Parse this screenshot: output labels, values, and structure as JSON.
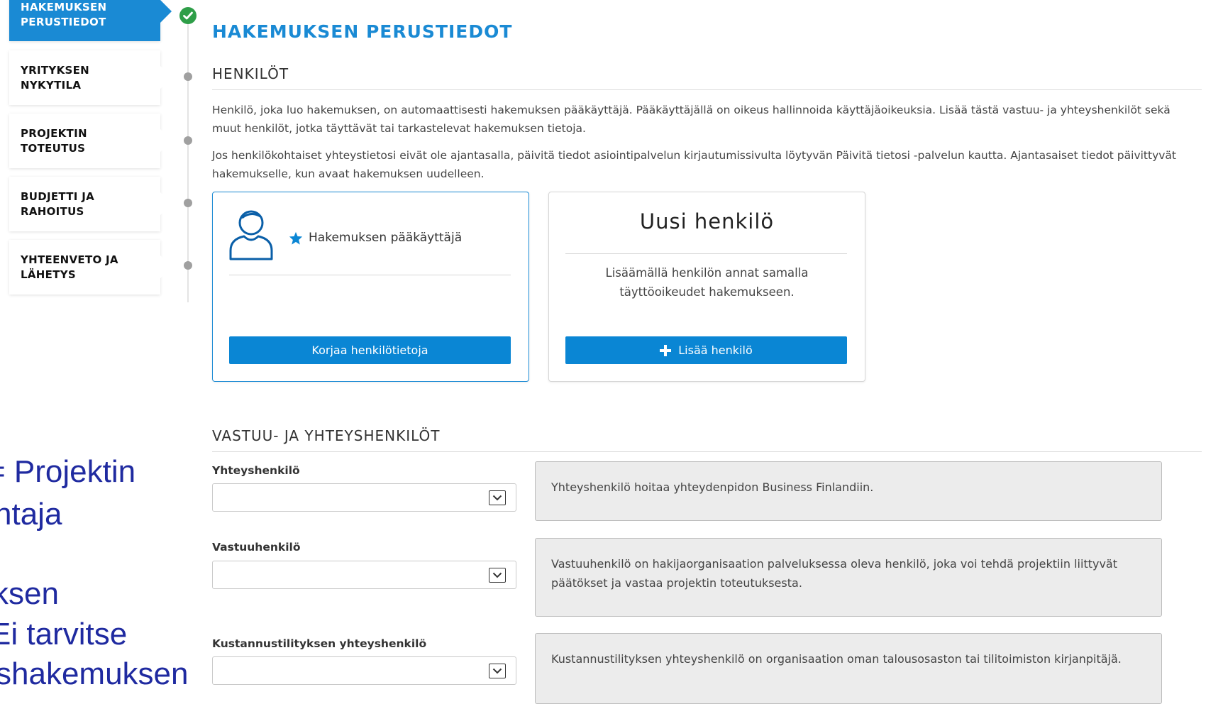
{
  "stepper": {
    "steps": [
      {
        "label_line1": "HAKEMUKSEN",
        "label_line2": "PERUSTIEDOT",
        "state": "completed-active"
      },
      {
        "label_line1": "YRITYKSEN",
        "label_line2": "NYKYTILA",
        "state": "pending"
      },
      {
        "label_line1": "PROJEKTIN",
        "label_line2": "TOTEUTUS",
        "state": "pending"
      },
      {
        "label_line1": "BUDJETTI JA",
        "label_line2": "RAHOITUS",
        "state": "pending"
      },
      {
        "label_line1": "YHTEENVETO JA",
        "label_line2": "LÄHETYS",
        "state": "pending"
      }
    ],
    "check_icon": "check-circle-icon",
    "active_color": "#1a8ad4",
    "check_color": "#2e9e48"
  },
  "overlay": {
    "lines": [
      "= Projektin",
      "ntaja",
      "",
      "ksen",
      "Ei tarvitse",
      "shakemuksen"
    ]
  },
  "main": {
    "page_title": "HAKEMUKSEN PERUSTIEDOT",
    "henkilot": {
      "title": "HENKILÖT",
      "para1": "Henkilö, joka luo hakemuksen, on automaattisesti hakemuksen pääkäyttäjä. Pääkäyttäjällä on oikeus hallinnoida käyttäjäoikeuksia. Lisää tästä vastuu- ja yhteyshenkilöt sekä muut henkilöt, jotka täyttävät tai tarkastelevat hakemuksen tietoja.",
      "para2": "Jos henkilökohtaiset yhteystietosi eivät ole ajantasalla, päivitä tiedot asiointipalvelun kirjautumissivulta löytyvän Päivitä tietosi -palvelun kautta. Ajantasaiset tiedot päivittyvät hakemukselle, kun avaat hakemuksen uudelleen."
    },
    "admin_card": {
      "role_label": "Hakemuksen pääkäyttäjä",
      "button_label": "Korjaa henkilötietoja"
    },
    "new_person_card": {
      "title": "Uusi henkilö",
      "description": "Lisäämällä henkilön annat samalla täyttöoikeudet hakemukseen.",
      "button_label": "Lisää henkilö"
    },
    "contacts": {
      "title": "VASTUU- JA YHTEYSHENKILÖT",
      "fields": [
        {
          "label": "Yhteyshenkilö",
          "value": "",
          "info": "Yhteyshenkilö hoitaa yhteydenpidon Business Finlandiin."
        },
        {
          "label": "Vastuuhenkilö",
          "value": "",
          "info": "Vastuuhenkilö on hakijaorganisaation palveluksessa oleva henkilö, joka voi tehdä projektiin liittyvät päätökset ja vastaa projektin toteutuksesta."
        },
        {
          "label": "Kustannustilityksen yhteyshenkilö",
          "value": "",
          "info": "Kustannustilityksen yhteyshenkilö on organisaation oman talousosaston tai tilitoimiston kirjanpitäjä."
        }
      ]
    },
    "accent_color": "#0a86d4"
  }
}
